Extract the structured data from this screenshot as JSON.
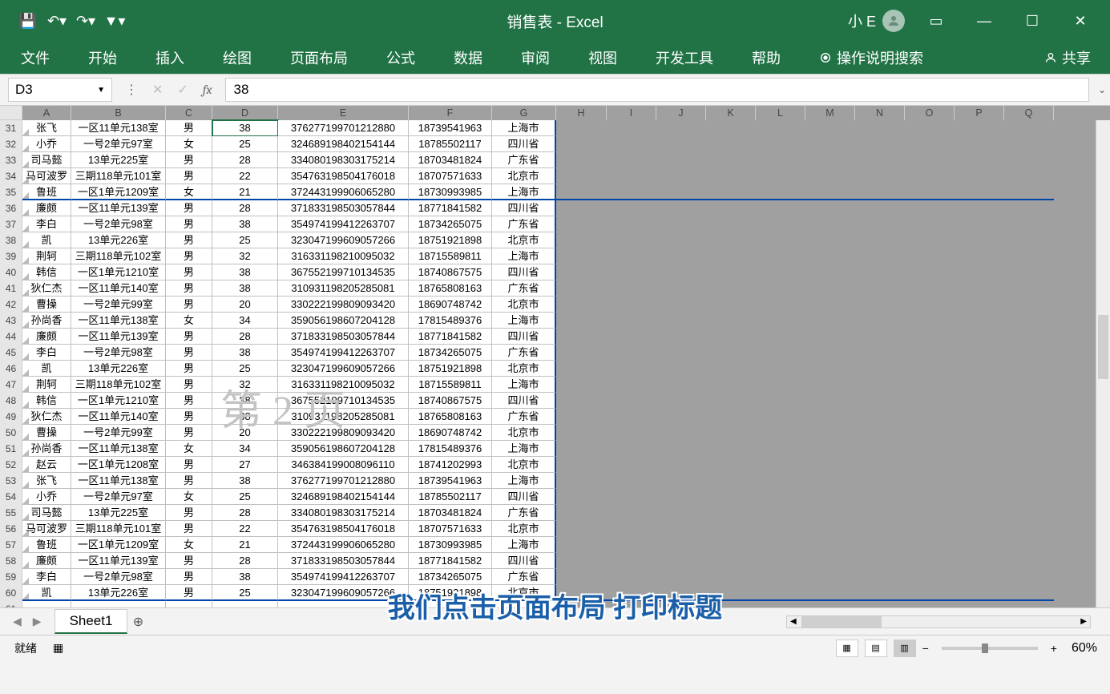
{
  "app_title": "销售表 - Excel",
  "user_name": "小 E",
  "ribbon_tabs": [
    "文件",
    "开始",
    "插入",
    "绘图",
    "页面布局",
    "公式",
    "数据",
    "审阅",
    "视图",
    "开发工具",
    "帮助"
  ],
  "tell_me": "操作说明搜索",
  "share": "共享",
  "name_box": "D3",
  "formula_value": "38",
  "columns": {
    "A": 61,
    "B": 118,
    "C": 58,
    "D": 82,
    "E": 163,
    "F": 104,
    "G": 80,
    "H": 63,
    "I": 62,
    "J": 62,
    "K": 62,
    "L": 62,
    "M": 62,
    "N": 62,
    "O": 62,
    "P": 62,
    "Q": 62
  },
  "row_start": 31,
  "row_end": 61,
  "page_break_rows": [
    35,
    60
  ],
  "selected_cell": {
    "row": 31,
    "col": "D"
  },
  "watermark_text": "第 2 页",
  "rows": [
    {
      "A": "张飞",
      "B": "一区11单元138室",
      "C": "男",
      "D": "38",
      "E": "376277199701212880",
      "F": "18739541963",
      "G": "上海市"
    },
    {
      "A": "小乔",
      "B": "一号2单元97室",
      "C": "女",
      "D": "25",
      "E": "324689198402154144",
      "F": "18785502117",
      "G": "四川省"
    },
    {
      "A": "司马懿",
      "B": "13单元225室",
      "C": "男",
      "D": "28",
      "E": "334080198303175214",
      "F": "18703481824",
      "G": "广东省"
    },
    {
      "A": "马可波罗",
      "B": "三期118单元101室",
      "C": "男",
      "D": "22",
      "E": "354763198504176018",
      "F": "18707571633",
      "G": "北京市"
    },
    {
      "A": "鲁班",
      "B": "一区1单元1209室",
      "C": "女",
      "D": "21",
      "E": "372443199906065280",
      "F": "18730993985",
      "G": "上海市"
    },
    {
      "A": "廉颇",
      "B": "一区11单元139室",
      "C": "男",
      "D": "28",
      "E": "371833198503057844",
      "F": "18771841582",
      "G": "四川省"
    },
    {
      "A": "李白",
      "B": "一号2单元98室",
      "C": "男",
      "D": "38",
      "E": "354974199412263707",
      "F": "18734265075",
      "G": "广东省"
    },
    {
      "A": "凯",
      "B": "13单元226室",
      "C": "男",
      "D": "25",
      "E": "323047199609057266",
      "F": "18751921898",
      "G": "北京市"
    },
    {
      "A": "荆轲",
      "B": "三期118单元102室",
      "C": "男",
      "D": "32",
      "E": "316331198210095032",
      "F": "18715589811",
      "G": "上海市"
    },
    {
      "A": "韩信",
      "B": "一区1单元1210室",
      "C": "男",
      "D": "38",
      "E": "367552199710134535",
      "F": "18740867575",
      "G": "四川省"
    },
    {
      "A": "狄仁杰",
      "B": "一区11单元140室",
      "C": "男",
      "D": "38",
      "E": "310931198205285081",
      "F": "18765808163",
      "G": "广东省"
    },
    {
      "A": "曹操",
      "B": "一号2单元99室",
      "C": "男",
      "D": "20",
      "E": "330222199809093420",
      "F": "18690748742",
      "G": "北京市"
    },
    {
      "A": "孙尚香",
      "B": "一区11单元138室",
      "C": "女",
      "D": "34",
      "E": "359056198607204128",
      "F": "17815489376",
      "G": "上海市"
    },
    {
      "A": "廉颇",
      "B": "一区11单元139室",
      "C": "男",
      "D": "28",
      "E": "371833198503057844",
      "F": "18771841582",
      "G": "四川省"
    },
    {
      "A": "李白",
      "B": "一号2单元98室",
      "C": "男",
      "D": "38",
      "E": "354974199412263707",
      "F": "18734265075",
      "G": "广东省"
    },
    {
      "A": "凯",
      "B": "13单元226室",
      "C": "男",
      "D": "25",
      "E": "323047199609057266",
      "F": "18751921898",
      "G": "北京市"
    },
    {
      "A": "荆轲",
      "B": "三期118单元102室",
      "C": "男",
      "D": "32",
      "E": "316331198210095032",
      "F": "18715589811",
      "G": "上海市"
    },
    {
      "A": "韩信",
      "B": "一区1单元1210室",
      "C": "男",
      "D": "38",
      "E": "367552199710134535",
      "F": "18740867575",
      "G": "四川省"
    },
    {
      "A": "狄仁杰",
      "B": "一区11单元140室",
      "C": "男",
      "D": "38",
      "E": "310931198205285081",
      "F": "18765808163",
      "G": "广东省"
    },
    {
      "A": "曹操",
      "B": "一号2单元99室",
      "C": "男",
      "D": "20",
      "E": "330222199809093420",
      "F": "18690748742",
      "G": "北京市"
    },
    {
      "A": "孙尚香",
      "B": "一区11单元138室",
      "C": "女",
      "D": "34",
      "E": "359056198607204128",
      "F": "17815489376",
      "G": "上海市"
    },
    {
      "A": "赵云",
      "B": "一区1单元1208室",
      "C": "男",
      "D": "27",
      "E": "346384199008096110",
      "F": "18741202993",
      "G": "北京市"
    },
    {
      "A": "张飞",
      "B": "一区11单元138室",
      "C": "男",
      "D": "38",
      "E": "376277199701212880",
      "F": "18739541963",
      "G": "上海市"
    },
    {
      "A": "小乔",
      "B": "一号2单元97室",
      "C": "女",
      "D": "25",
      "E": "324689198402154144",
      "F": "18785502117",
      "G": "四川省"
    },
    {
      "A": "司马懿",
      "B": "13单元225室",
      "C": "男",
      "D": "28",
      "E": "334080198303175214",
      "F": "18703481824",
      "G": "广东省"
    },
    {
      "A": "马可波罗",
      "B": "三期118单元101室",
      "C": "男",
      "D": "22",
      "E": "354763198504176018",
      "F": "18707571633",
      "G": "北京市"
    },
    {
      "A": "鲁班",
      "B": "一区1单元1209室",
      "C": "女",
      "D": "21",
      "E": "372443199906065280",
      "F": "18730993985",
      "G": "上海市"
    },
    {
      "A": "廉颇",
      "B": "一区11单元139室",
      "C": "男",
      "D": "28",
      "E": "371833198503057844",
      "F": "18771841582",
      "G": "四川省"
    },
    {
      "A": "李白",
      "B": "一号2单元98室",
      "C": "男",
      "D": "38",
      "E": "354974199412263707",
      "F": "18734265075",
      "G": "广东省"
    },
    {
      "A": "凯",
      "B": "13单元226室",
      "C": "男",
      "D": "25",
      "E": "323047199609057266",
      "F": "18751921898",
      "G": "北京市"
    }
  ],
  "sheet_name": "Sheet1",
  "status_ready": "就绪",
  "zoom_level": "60%",
  "subtitle_overlay": "我们点击页面布局 打印标题"
}
